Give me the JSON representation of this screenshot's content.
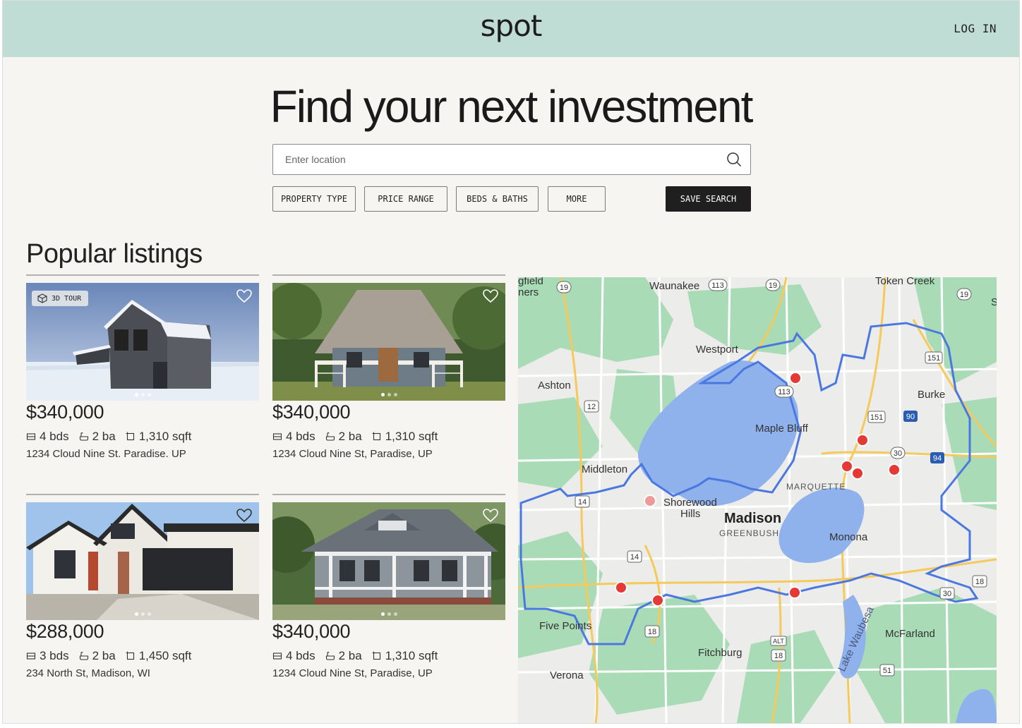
{
  "header": {
    "logo": "spot",
    "login_label": "LOG IN"
  },
  "hero": {
    "title": "Find your next investment"
  },
  "search": {
    "placeholder": "Enter location"
  },
  "filters": {
    "property_type": "PROPERTY TYPE",
    "price_range": "PRICE RANGE",
    "beds_baths": "BEDS & BATHS",
    "more": "MORE",
    "save_search": "SAVE SEARCH"
  },
  "section": {
    "title": "Popular listings"
  },
  "listings": [
    {
      "price": "$340,000",
      "beds": "4 bds",
      "baths": "2 ba",
      "sqft": "1,310 sqft",
      "address": "1234 Cloud Nine St. Paradise. UP",
      "badge": "3D TOUR",
      "photo": "snowy-barn-house"
    },
    {
      "price": "$340,000",
      "beds": "4 bds",
      "baths": "2 ba",
      "sqft": "1,310 sqft",
      "address": "1234 Cloud Nine St, Paradise, UP",
      "photo": "cottage-porch-house"
    },
    {
      "price": "$288,000",
      "beds": "3 bds",
      "baths": "2 ba",
      "sqft": "1,450 sqft",
      "address": "234 North St, Madison, WI",
      "photo": "modern-garage-house"
    },
    {
      "price": "$340,000",
      "beds": "4 bds",
      "baths": "2 ba",
      "sqft": "1,310 sqft",
      "address": "1234 Cloud Nine St, Paradise, UP",
      "photo": "gray-porch-house"
    }
  ],
  "map": {
    "places": {
      "waunakee": "Waunakee",
      "token_creek": "Token Creek",
      "westport": "Westport",
      "ashton": "Ashton",
      "maple_bluff": "Maple Bluff",
      "burke": "Burke",
      "middleton": "Middleton",
      "marquette": "MARQUETTE",
      "shorewood": "Shorewood",
      "hills": "Hills",
      "madison": "Madison",
      "greenbush": "GREENBUSH",
      "monona": "Monona",
      "five_points": "Five Points",
      "mcfarland": "McFarland",
      "fitchburg": "Fitchburg",
      "verona": "Verona",
      "lake_waubesa": "Lake Waubesa",
      "gfield": "gfield",
      "ners": "ners",
      "edge_s": "S"
    },
    "shields": [
      "19",
      "113",
      "19",
      "19",
      "113",
      "12",
      "14",
      "14",
      "151",
      "151",
      "30",
      "90",
      "94",
      "18",
      "18",
      "18",
      "51",
      "30",
      "ALT"
    ],
    "colors": {
      "pin": "#e53935",
      "pin_faded": "#ef9a9a",
      "boundary": "#4a78e0",
      "water": "#8fb1ec",
      "park": "#a8dcb5"
    }
  }
}
